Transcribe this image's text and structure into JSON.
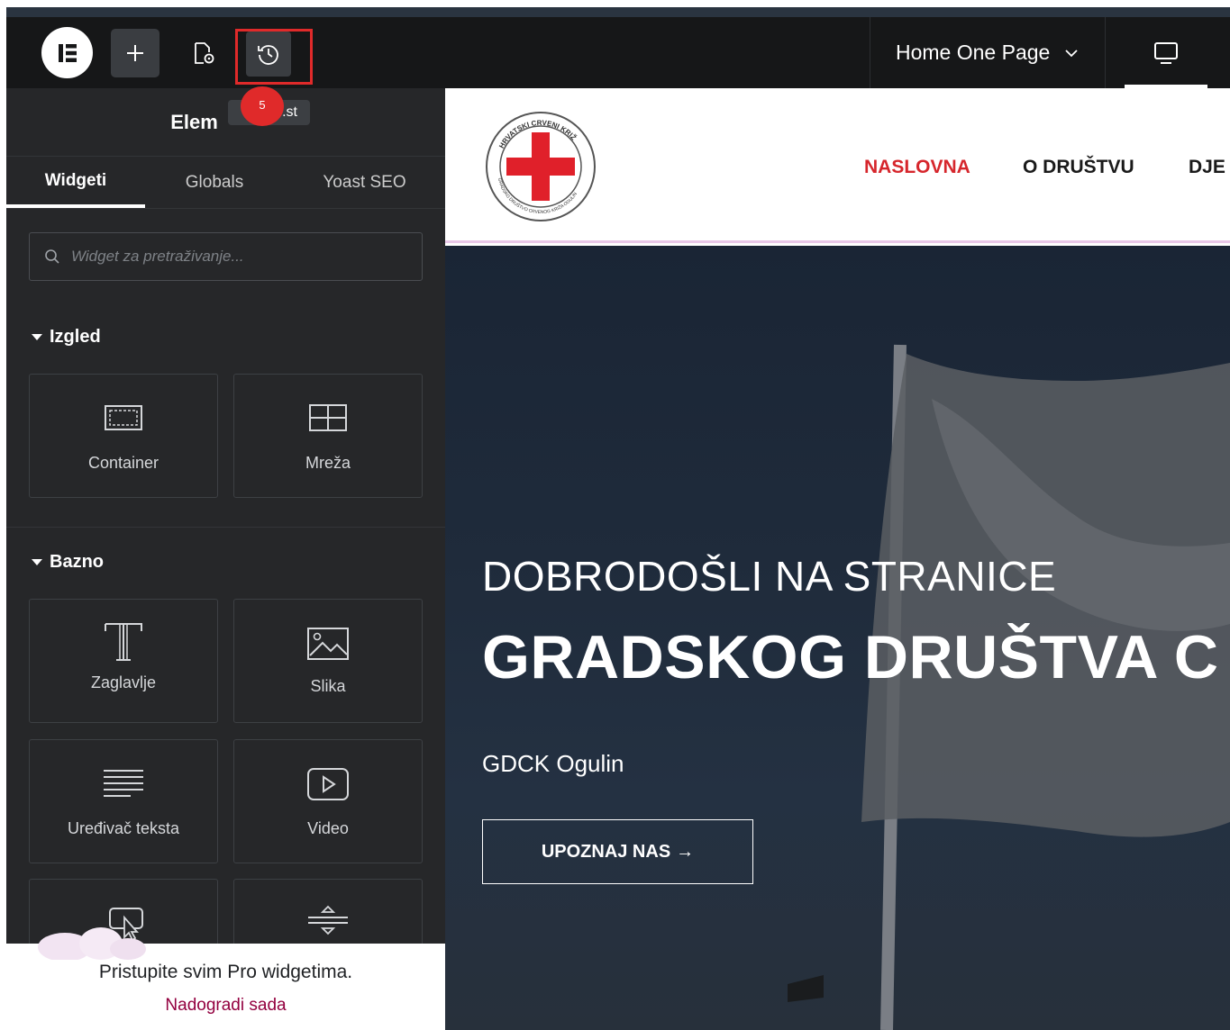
{
  "topbar": {
    "page_title": "Home One Page",
    "history_badge": "5",
    "history_tooltip": "...st"
  },
  "panel": {
    "title": "Elementi",
    "title_visible": "Elem",
    "tabs": [
      "Widgeti",
      "Globals",
      "Yoast SEO"
    ],
    "search_placeholder": "Widget za pretraživanje...",
    "sections": [
      {
        "title": "Izgled",
        "widgets": [
          "Container",
          "Mreža"
        ]
      },
      {
        "title": "Bazno",
        "widgets": [
          "Zaglavlje",
          "Slika",
          "Uređivač teksta",
          "Video"
        ]
      }
    ],
    "promo_text": "Pristupite svim Pro widgetima.",
    "promo_link": "Nadogradi sada"
  },
  "site": {
    "nav": [
      "NASLOVNA",
      "O DRUŠTVU",
      "DJE"
    ],
    "logo_top_text": "HRVATSKI CRVENI KRIŽ",
    "logo_bottom_text": "GRADSKO DRUŠTVO CRVENOG KRIŽA OGULIN",
    "hero_subtitle": "DOBRODOŠLI NA STRANICE",
    "hero_title": "GRADSKOG DRUŠTVA C",
    "hero_org": "GDCK Ogulin",
    "hero_button": "UPOZNAJ NAS",
    "hero_button_arrow": "→"
  },
  "colors": {
    "topbar_bg": "#161718",
    "panel_bg": "#262729",
    "highlight_red": "#e02a2a",
    "nav_active": "#d6262c",
    "promo_link": "#93003f"
  }
}
